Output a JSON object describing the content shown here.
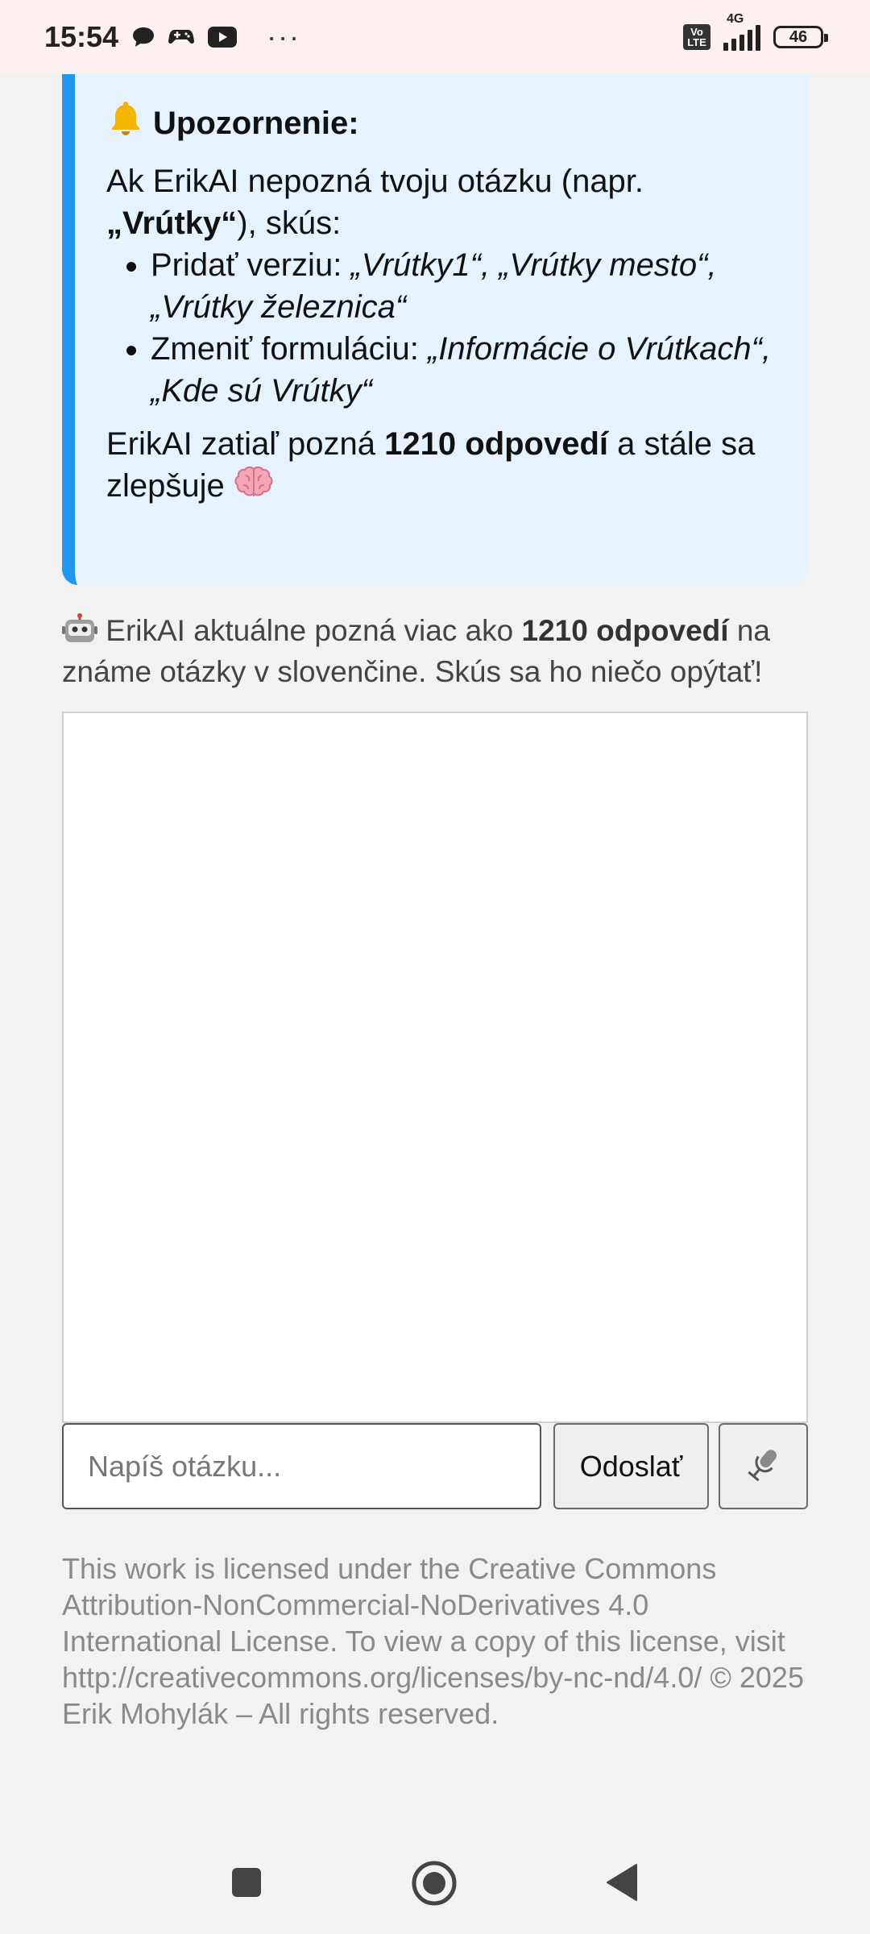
{
  "status_bar": {
    "time": "15:54",
    "network": "4G",
    "volte_label": "Vo LTE",
    "battery": "46",
    "more": "···"
  },
  "notice": {
    "icon": "bell",
    "title": "Upozornenie:",
    "line1_prefix": "Ak ErikAI nepozná tvoju otázku (napr. ",
    "line1_example": "„Vrútky“",
    "line1_suffix": "), skús:",
    "bullets": [
      {
        "label": "Pridať verziu: ",
        "examples": "„Vrútky1“, „Vrútky mesto“, „Vrútky železnica“"
      },
      {
        "label": "Zmeniť formuláciu: ",
        "examples": "„Informácie o Vrútkach“, „Kde sú Vrútky“"
      }
    ],
    "stat_prefix": "ErikAI zatiaľ pozná ",
    "stat_count": "1210 odpovedí",
    "stat_suffix": " a stále sa zlepšuje "
  },
  "intro": {
    "prefix": "ErikAI aktuálne pozná viac ako ",
    "count": "1210 odpovedí",
    "suffix": " na známe otázky v slovenčine. Skús sa ho niečo opýtať!"
  },
  "input": {
    "placeholder": "Napíš otázku...",
    "value": ""
  },
  "buttons": {
    "send": "Odoslať",
    "mic": "microphone"
  },
  "license_text": "This work is licensed under the Creative Commons Attribution-NonCommercial-NoDerivatives 4.0 International License. To view a copy of this license, visit http://creativecommons.org/licenses/by-nc-nd/4.0/ © 2025 Erik Mohylák – All rights reserved.",
  "colors": {
    "accent": "#2196f3",
    "notice_bg": "#e6f2fd",
    "page_bg": "#f2f2f2",
    "status_bg": "#fdf1ef"
  }
}
